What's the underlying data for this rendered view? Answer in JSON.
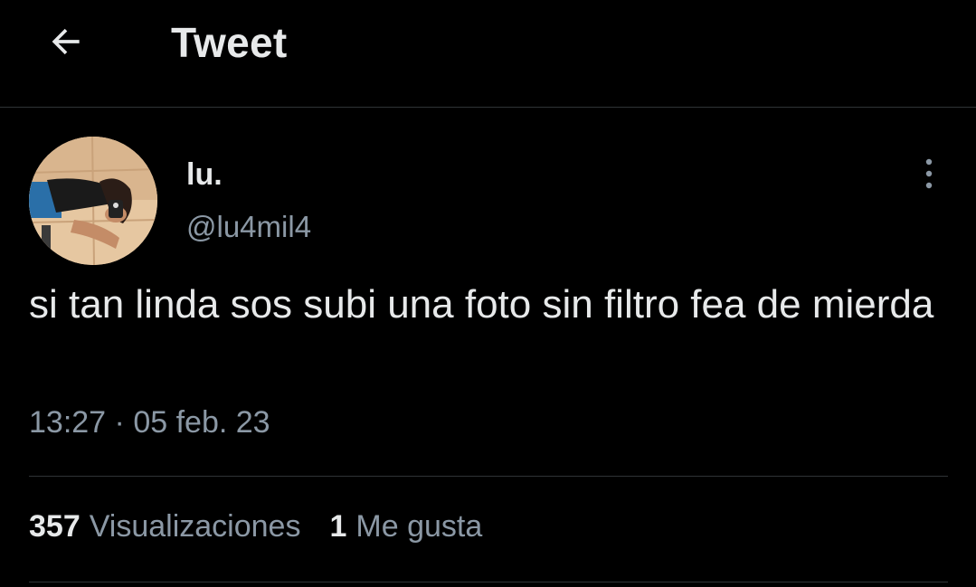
{
  "header": {
    "back_icon": "arrow-left-icon",
    "title": "Tweet"
  },
  "tweet": {
    "author": {
      "display_name": "lu.",
      "handle": "@lu4mil4",
      "avatar": "profile-photo"
    },
    "more_icon": "vertical-ellipsis-icon",
    "text": "si tan linda sos subi una foto sin filtro fea de mierda",
    "time": "13:27",
    "separator": "·",
    "date": "05 feb. 23",
    "stats": {
      "views_count": "357",
      "views_label": "Visualizaciones",
      "likes_count": "1",
      "likes_label": "Me gusta"
    }
  },
  "colors": {
    "background": "#000000",
    "primary_text": "#e7e9ea",
    "secondary_text": "#8b98a5",
    "divider": "#2f3336"
  }
}
